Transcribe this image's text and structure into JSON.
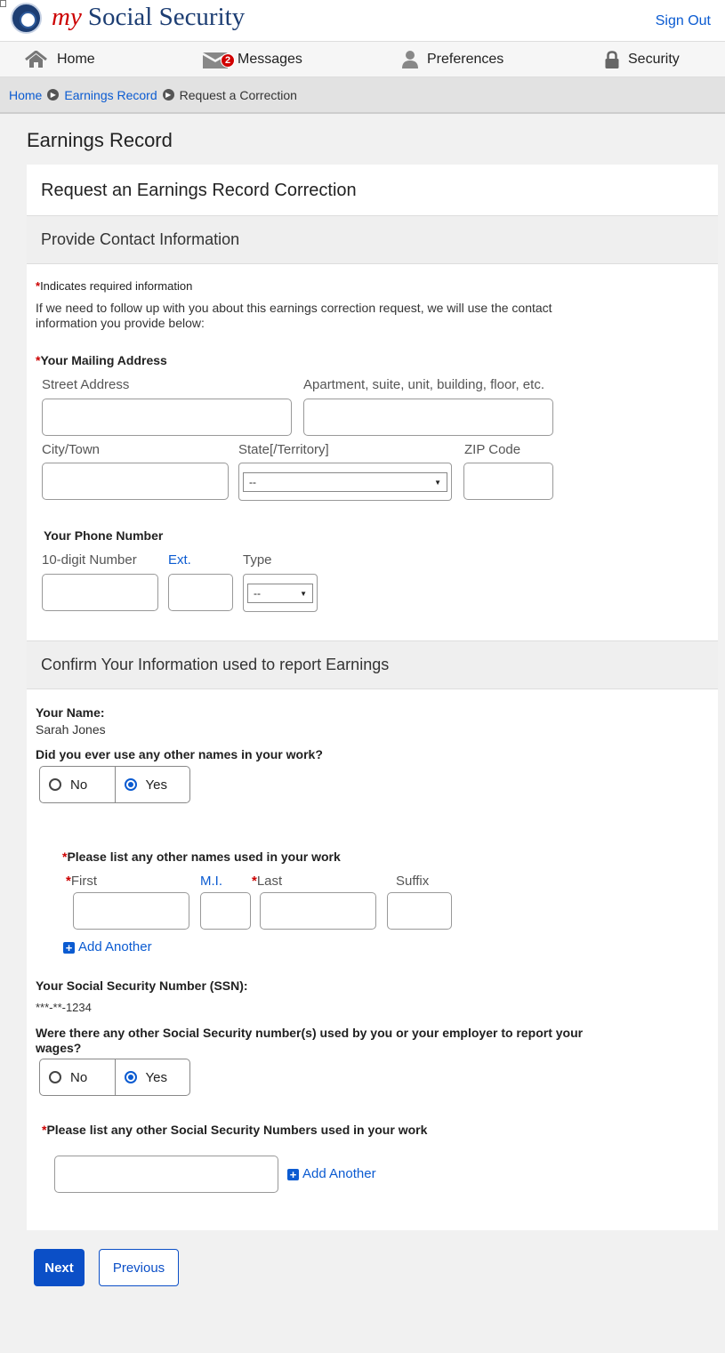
{
  "header": {
    "brand_my": "my",
    "brand_name": "Social Security",
    "sign_out": "Sign Out"
  },
  "nav": {
    "home": "Home",
    "messages": "Messages",
    "messages_count": "2",
    "preferences": "Preferences",
    "security": "Security"
  },
  "breadcrumb": [
    "Home",
    "Earnings Record",
    "Request a Correction"
  ],
  "page_title": "Earnings Record",
  "card_title": "Request an Earnings Record Correction",
  "contact": {
    "section_title": "Provide Contact Information",
    "required_star": "*",
    "required_note": "Indicates required information",
    "intro_line1": "If we need to follow up with you about this earnings correction request, we will use the contact",
    "intro_line2": "information you provide below:",
    "mailing_label": "Your Mailing Address",
    "street_label": "Street Address",
    "apt_label": "Apartment, suite, unit, building, floor, etc.",
    "city_label": "City/Town",
    "state_label": "State[/Territory]",
    "state_value": "--",
    "zip_label": "ZIP Code",
    "phone_title": "Your Phone Number",
    "phone_number_label": "10-digit Number",
    "ext_label": "Ext.",
    "type_label": "Type",
    "type_value": "--"
  },
  "confirm": {
    "section_title": "Confirm Your Information used to report Earnings",
    "name_label": "Your Name:",
    "name_value": "Sarah Jones",
    "other_names_q": "Did you ever use any other names in your work?",
    "no": "No",
    "yes": "Yes",
    "other_names_list": "Please list any other names used in your work",
    "first_label": "First",
    "mi_label": "M.I.",
    "last_label": "Last",
    "suffix_label": "Suffix",
    "add_another": "Add Another",
    "ssn_label": "Your Social Security Number (SSN):",
    "ssn_value": "***-**-1234",
    "other_ssn_q1": "Were there any other Social Security number(s) used by you or your employer to report your",
    "other_ssn_q2": "wages?",
    "other_ssn_list": "Please list any other Social Security Numbers used in your work"
  },
  "buttons": {
    "next": "Next",
    "previous": "Previous"
  }
}
